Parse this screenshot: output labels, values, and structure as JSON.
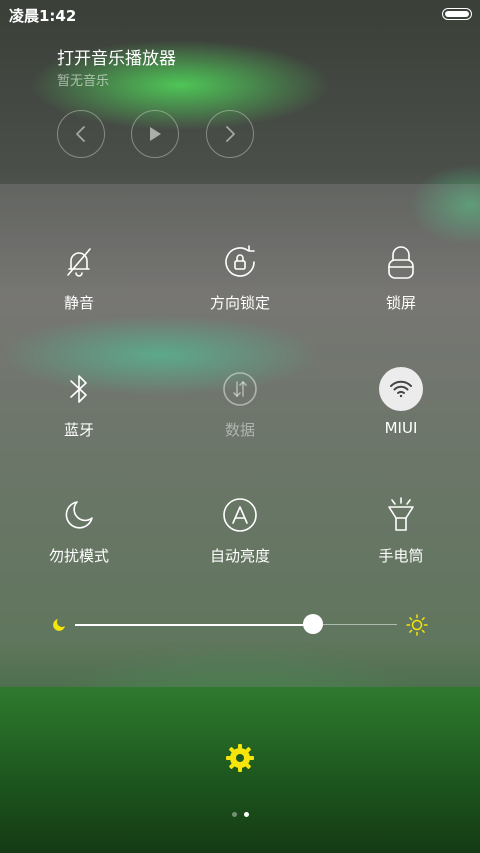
{
  "status_bar": {
    "time": "凌晨1:42",
    "battery_icon": "battery-icon"
  },
  "music": {
    "title": "打开音乐播放器",
    "subtitle": "暂无音乐",
    "controls": [
      "prev-icon",
      "play-icon",
      "next-icon"
    ]
  },
  "toggles": [
    {
      "label": "静音",
      "icon": "mute-bell-icon",
      "enabled": false
    },
    {
      "label": "方向锁定",
      "icon": "rotation-lock-icon",
      "enabled": false
    },
    {
      "label": "锁屏",
      "icon": "lock-icon",
      "enabled": false
    },
    {
      "label": "蓝牙",
      "icon": "bluetooth-icon",
      "enabled": false
    },
    {
      "label": "数据",
      "icon": "mobile-data-icon",
      "enabled": false
    },
    {
      "label": "MIUI",
      "icon": "wifi-icon",
      "enabled": true
    },
    {
      "label": "勿扰模式",
      "icon": "moon-icon",
      "enabled": false
    },
    {
      "label": "自动亮度",
      "icon": "auto-brightness-icon",
      "enabled": false
    },
    {
      "label": "手电筒",
      "icon": "flashlight-icon",
      "enabled": false
    }
  ],
  "brightness": {
    "value": 0.74,
    "accent": "#f5e50a"
  },
  "settings": {
    "icon": "gear-icon",
    "color": "#f5e50a"
  },
  "pager": {
    "pages": 2,
    "current": 2
  }
}
